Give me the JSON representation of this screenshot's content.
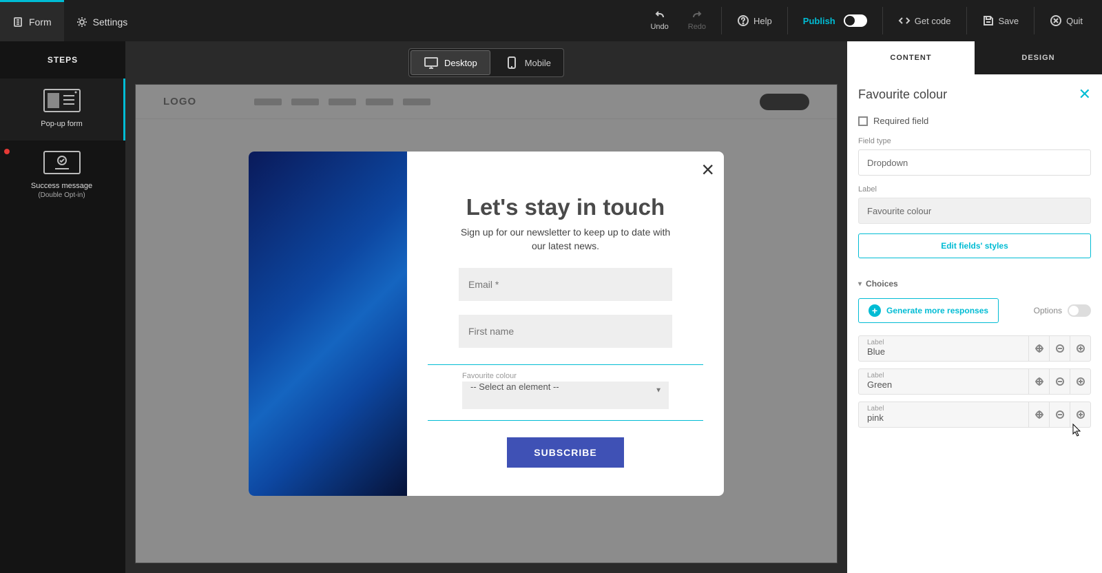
{
  "top": {
    "form_tab": "Form",
    "settings_tab": "Settings",
    "undo": "Undo",
    "redo": "Redo",
    "help": "Help",
    "publish": "Publish",
    "get_code": "Get code",
    "save": "Save",
    "quit": "Quit"
  },
  "sidebar": {
    "header": "STEPS",
    "step1_title": "Pop-up form",
    "step2_title": "Success message",
    "step2_sub": "(Double Opt-in)"
  },
  "canvas": {
    "desktop": "Desktop",
    "mobile": "Mobile",
    "logo": "LOGO",
    "popup": {
      "title": "Let's stay in touch",
      "sub": "Sign up for our newsletter to keep up to date with our latest news.",
      "email_ph": "Email *",
      "fname_ph": "First name",
      "select_label": "Favourite colour",
      "select_ph": "-- Select an element --",
      "subscribe": "SUBSCRIBE"
    }
  },
  "panel": {
    "tab_content": "CONTENT",
    "tab_design": "DESIGN",
    "title": "Favourite colour",
    "required": "Required field",
    "field_type_label": "Field type",
    "field_type_value": "Dropdown",
    "label_label": "Label",
    "label_value": "Favourite colour",
    "edit_styles": "Edit fields' styles",
    "choices_header": "Choices",
    "generate": "Generate more responses",
    "options": "Options",
    "item_label": "Label",
    "choices": [
      {
        "value": "Blue"
      },
      {
        "value": "Green"
      },
      {
        "value": "pink"
      }
    ]
  }
}
